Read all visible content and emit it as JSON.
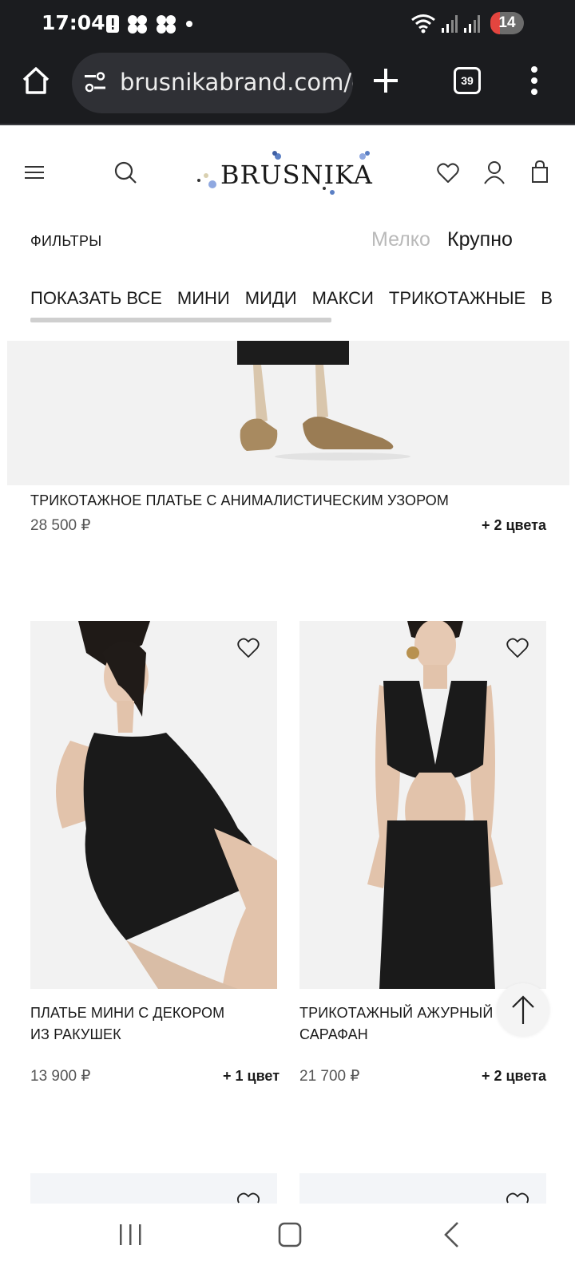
{
  "status_bar": {
    "time": "17:04",
    "battery": "14"
  },
  "browser": {
    "url": "brusnikabrand.com/c",
    "tab_count": "39"
  },
  "site": {
    "logo": "BRUSNIKA",
    "filters_label": "ФИЛЬТРЫ",
    "view_small": "Мелко",
    "view_large": "Крупно",
    "categories": [
      "ПОКАЗАТЬ ВСЕ",
      "МИНИ",
      "МИДИ",
      "МАКСИ",
      "ТРИКОТАЖНЫЕ",
      "В"
    ],
    "category_scroll_fraction": 0.58
  },
  "products": [
    {
      "title": "ТРИКОТАЖНОЕ ПЛАТЬЕ С АНИМАЛИСТИЧЕСКИМ УЗОРОМ",
      "price": "28 500 ₽",
      "colors": "+ 2 цвета"
    },
    {
      "title_line1": "ПЛАТЬЕ МИНИ С ДЕКОРОМ",
      "title_line2": "ИЗ РАКУШЕК",
      "price": "13 900 ₽",
      "colors": "+ 1 цвет"
    },
    {
      "title_line1": "ТРИКОТАЖНЫЙ АЖУРНЫЙ",
      "title_line2": "САРАФАН",
      "price": "21 700 ₽",
      "colors": "+ 2 цвета"
    }
  ],
  "colors": {
    "chrome_bg": "#1b1c1f",
    "urlbar_bg": "#2f3035",
    "battery_low": "#e3453f"
  }
}
